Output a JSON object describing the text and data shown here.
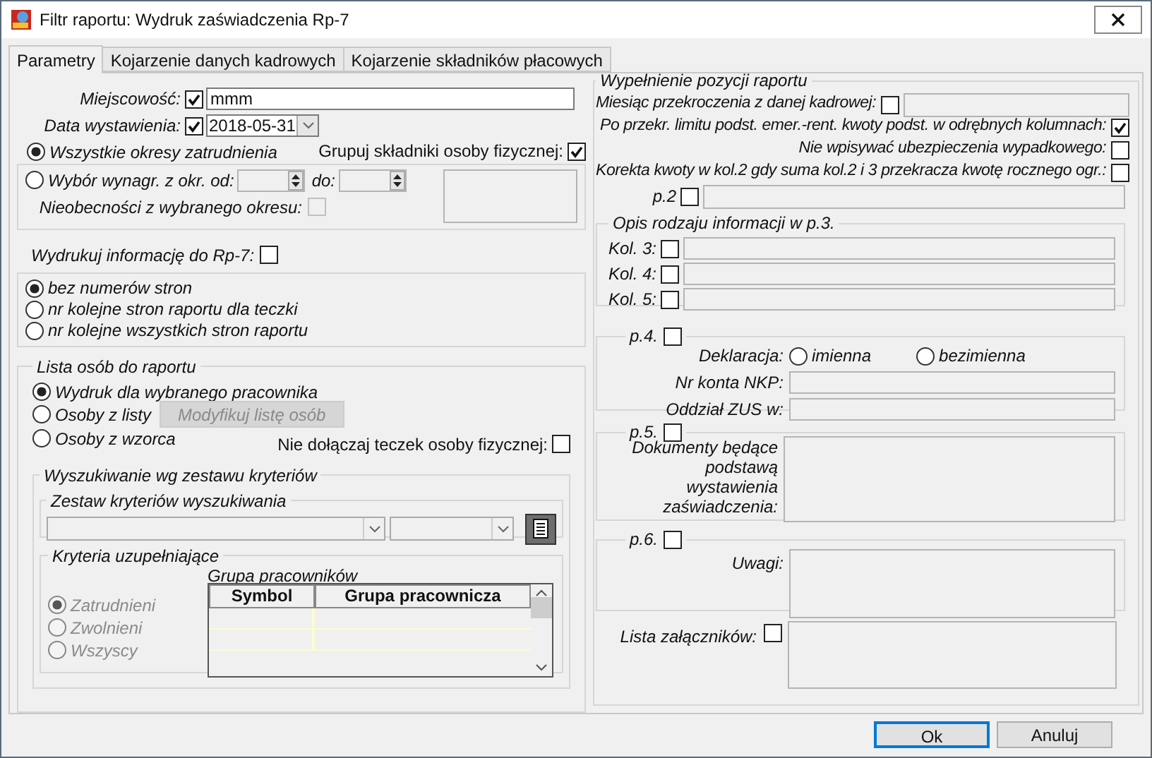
{
  "window": {
    "title": "Filtr raportu: Wydruk zaświadczenia Rp-7"
  },
  "tabs": [
    {
      "label": "Parametry",
      "selected": true
    },
    {
      "label": "Kojarzenie danych kadrowych",
      "selected": false
    },
    {
      "label": "Kojarzenie składników płacowych",
      "selected": false
    }
  ],
  "left": {
    "place": {
      "label": "Miejscowość:",
      "checked": true,
      "value": "mmm"
    },
    "issue_date": {
      "label": "Data wystawienia:",
      "checked": true,
      "value": "2018-05-31"
    },
    "period_options": [
      {
        "label": "Wszystkie okresy zatrudnienia",
        "selected": true
      },
      {
        "label": "Wybór wynagr. z okr. od:",
        "selected": false
      }
    ],
    "to_label": "do:",
    "group_components": {
      "label": "Grupuj składniki osoby fizycznej:",
      "checked": true
    },
    "absences": {
      "label": "Nieobecności z wybranego okresu:",
      "checked": false,
      "disabled": true
    },
    "print_info": {
      "label": "Wydrukuj informację do Rp-7:",
      "checked": false
    },
    "page_numbering": [
      {
        "label": "bez numerów stron",
        "selected": true
      },
      {
        "label": "nr kolejne stron raportu dla teczki",
        "selected": false
      },
      {
        "label": "nr kolejne wszystkich stron raportu",
        "selected": false
      }
    ],
    "person_list": {
      "title": "Lista osób do raportu",
      "options": [
        {
          "label": "Wydruk dla wybranego pracownika",
          "selected": true
        },
        {
          "label": "Osoby z listy",
          "selected": false
        },
        {
          "label": "Osoby z wzorca",
          "selected": false
        }
      ],
      "modify_button": {
        "label": "Modyfikuj listę osób",
        "disabled": true
      },
      "exclude_folders": {
        "label": "Nie dołączaj teczek osoby fizycznej:",
        "checked": false
      }
    },
    "search": {
      "title": "Wyszukiwanie wg zestawu kryteriów",
      "criteria_set_title": "Zestaw kryteriów wyszukiwania",
      "supplementary": {
        "title": "Kryteria uzupełniające",
        "status_options": [
          {
            "label": "Zatrudnieni",
            "selected": true,
            "disabled": true
          },
          {
            "label": "Zwolnieni",
            "selected": false,
            "disabled": true
          },
          {
            "label": "Wszyscy",
            "selected": false,
            "disabled": true
          }
        ],
        "table": {
          "title": "Grupa pracowników",
          "columns": [
            "Symbol",
            "Grupa pracownicza"
          ]
        }
      }
    }
  },
  "right": {
    "title": "Wypełnienie pozycji raportu",
    "options": [
      {
        "kind": "field",
        "label": "Miesiąc przekroczenia z danej kadrowej:",
        "checked": false
      },
      {
        "kind": "check",
        "label": "Po przekr. limitu podst. emer.-rent. kwoty podst. w odrębnych kolumnach:",
        "checked": true
      },
      {
        "kind": "check",
        "label": "Nie wpisywać ubezpieczenia wypadkowego:",
        "checked": false
      },
      {
        "kind": "check",
        "label": "Korekta kwoty w kol.2 gdy suma kol.2 i 3 przekracza kwotę rocznego ogr.:",
        "checked": false
      }
    ],
    "p2": {
      "label": "p.2",
      "checked": false
    },
    "info_description": {
      "title": "Opis rodzaju informacji w p.3.",
      "rows": [
        {
          "label": "Kol. 3:",
          "checked": false
        },
        {
          "label": "Kol. 4:",
          "checked": false
        },
        {
          "label": "Kol. 5:",
          "checked": false
        }
      ]
    },
    "p4": {
      "label": "p.4.",
      "checked": false,
      "declaration_label": "Deklaracja:",
      "declaration_options": [
        {
          "label": "imienna",
          "selected": false
        },
        {
          "label": "bezimienna",
          "selected": false
        }
      ],
      "fields": [
        "Nr konta NKP:",
        "Oddział ZUS w:"
      ]
    },
    "p5": {
      "label": "p.5.",
      "checked": false,
      "field_label": "Dokumenty będące podstawą wystawienia zaświadczenia:"
    },
    "p6": {
      "label": "p.6.",
      "checked": false,
      "field_label": "Uwagi:"
    },
    "attachments": {
      "label": "Lista załączników:",
      "checked": false
    }
  },
  "buttons": [
    {
      "label": "Ok",
      "default": true
    },
    {
      "label": "Anuluj",
      "default": false
    }
  ]
}
